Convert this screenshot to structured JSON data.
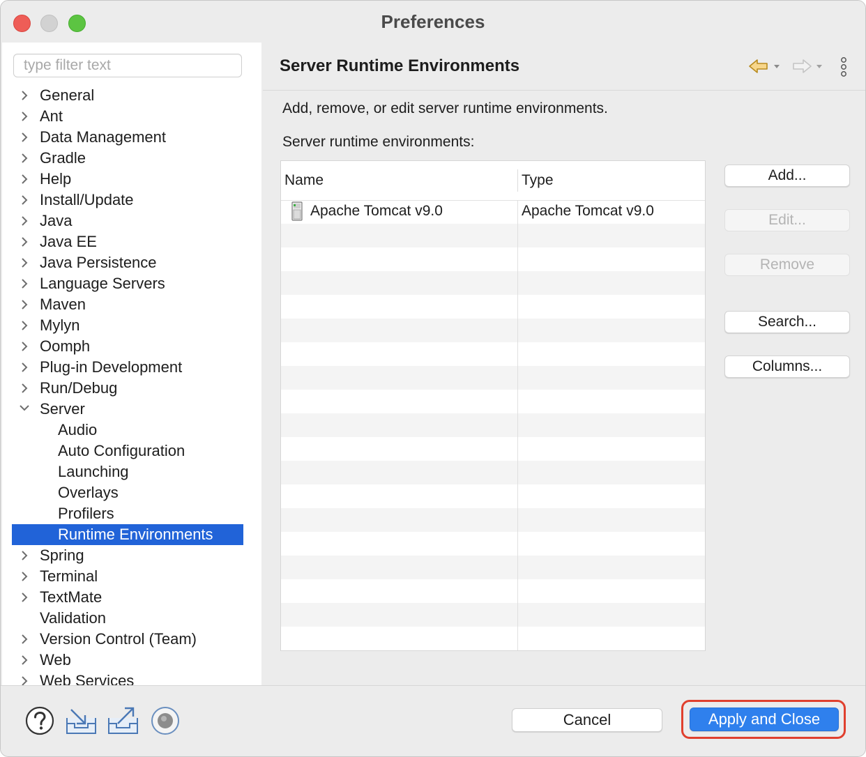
{
  "window": {
    "title": "Preferences"
  },
  "filter": {
    "placeholder": "type filter text",
    "value": ""
  },
  "tree": [
    {
      "label": "General",
      "expandable": true
    },
    {
      "label": "Ant",
      "expandable": true
    },
    {
      "label": "Data Management",
      "expandable": true
    },
    {
      "label": "Gradle",
      "expandable": true
    },
    {
      "label": "Help",
      "expandable": true
    },
    {
      "label": "Install/Update",
      "expandable": true
    },
    {
      "label": "Java",
      "expandable": true
    },
    {
      "label": "Java EE",
      "expandable": true
    },
    {
      "label": "Java Persistence",
      "expandable": true
    },
    {
      "label": "Language Servers",
      "expandable": true
    },
    {
      "label": "Maven",
      "expandable": true
    },
    {
      "label": "Mylyn",
      "expandable": true
    },
    {
      "label": "Oomph",
      "expandable": true
    },
    {
      "label": "Plug-in Development",
      "expandable": true
    },
    {
      "label": "Run/Debug",
      "expandable": true
    },
    {
      "label": "Server",
      "expandable": true,
      "expanded": true
    },
    {
      "label": "Audio",
      "child": true
    },
    {
      "label": "Auto Configuration",
      "child": true
    },
    {
      "label": "Launching",
      "child": true
    },
    {
      "label": "Overlays",
      "child": true
    },
    {
      "label": "Profilers",
      "child": true
    },
    {
      "label": "Runtime Environments",
      "child": true,
      "selected": true
    },
    {
      "label": "Spring",
      "expandable": true
    },
    {
      "label": "Terminal",
      "expandable": true
    },
    {
      "label": "TextMate",
      "expandable": true
    },
    {
      "label": "Validation",
      "expandable": false
    },
    {
      "label": "Version Control (Team)",
      "expandable": true
    },
    {
      "label": "Web",
      "expandable": true
    },
    {
      "label": "Web Services",
      "expandable": true
    }
  ],
  "page": {
    "title": "Server Runtime Environments",
    "description": "Add, remove, or edit server runtime environments.",
    "list_label": "Server runtime environments:"
  },
  "table": {
    "columns": [
      "Name",
      "Type"
    ],
    "rows": [
      {
        "name": "Apache Tomcat v9.0",
        "type": "Apache Tomcat v9.0"
      }
    ]
  },
  "buttons": {
    "add": "Add...",
    "edit": "Edit...",
    "remove": "Remove",
    "search": "Search...",
    "columns": "Columns...",
    "cancel": "Cancel",
    "apply_close": "Apply and Close"
  },
  "colors": {
    "selection": "#2163d8",
    "primary_button": "#2f80ed",
    "highlight_ring": "#e0402e"
  },
  "icons": {
    "back": "back-arrow-icon",
    "forward": "forward-arrow-icon",
    "menu": "view-menu-icon",
    "help": "help-icon",
    "import": "import-icon",
    "export": "export-icon",
    "record": "record-icon",
    "server": "server-icon"
  }
}
